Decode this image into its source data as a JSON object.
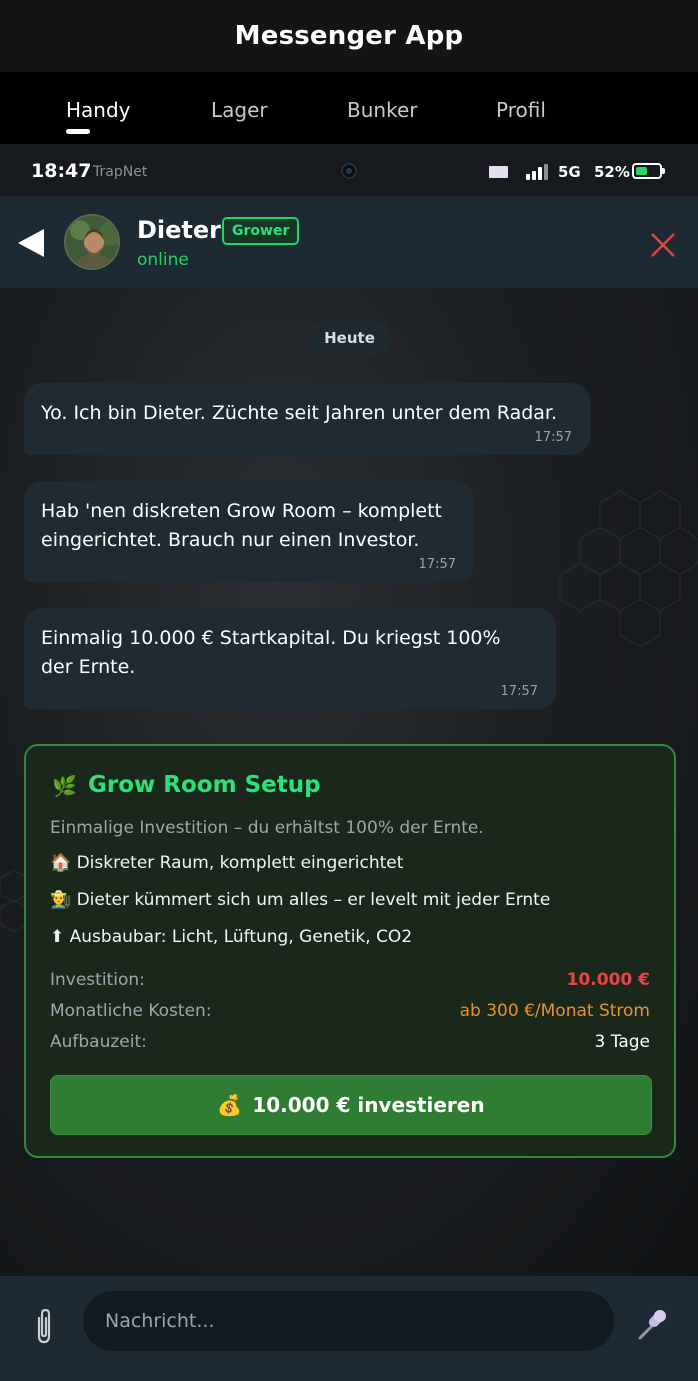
{
  "app": {
    "title": "Messenger App"
  },
  "tabs": [
    {
      "label": "Handy",
      "active": true
    },
    {
      "label": "Lager",
      "active": false
    },
    {
      "label": "Bunker",
      "active": false
    },
    {
      "label": "Profil",
      "active": false
    }
  ],
  "statusbar": {
    "time": "18:47",
    "carrier": "TrapNet",
    "network": "5G",
    "battery_text": "52%",
    "battery_level": 0.52,
    "battery_color": "#2ed35a"
  },
  "contact": {
    "name": "Dieter",
    "role": "Grower",
    "status": "online",
    "accent": "#22d36b"
  },
  "chat": {
    "date_label": "Heute",
    "messages": [
      {
        "text": "Yo. Ich bin Dieter. Züchte seit Jahren unter dem Radar.",
        "time": "17:57"
      },
      {
        "text": "Hab 'nen diskreten Grow Room – komplett eingerichtet. Brauch nur einen Investor.",
        "time": "17:57"
      },
      {
        "text": "Einmalig 10.000 € Startkapital. Du kriegst 100% der Ernte.",
        "time": "17:57"
      }
    ]
  },
  "offer": {
    "icon": "🌿",
    "title": "Grow Room Setup",
    "subtitle": "Einmalige Investition – du erhältst 100% der Ernte.",
    "features": [
      "🏠 Diskreter Raum, komplett eingerichtet",
      "👨‍🌾 Dieter kümmert sich um alles – er levelt mit jeder Ernte",
      "⬆ Ausbaubar: Licht, Lüftung, Genetik, CO2"
    ],
    "rows": [
      {
        "label": "Investition:",
        "value": "10.000 €"
      },
      {
        "label": "Monatliche Kosten:",
        "value": "ab 300 €/Monat Strom"
      },
      {
        "label": "Aufbauzeit:",
        "value": "3 Tage"
      }
    ],
    "button_icon": "💰",
    "button_label": "10.000 € investieren",
    "colors": {
      "invest": "#e84545",
      "costs": "#e8922c",
      "button": "#2e7d32",
      "title": "#2ae27a"
    }
  },
  "input": {
    "placeholder": "Nachricht..."
  }
}
